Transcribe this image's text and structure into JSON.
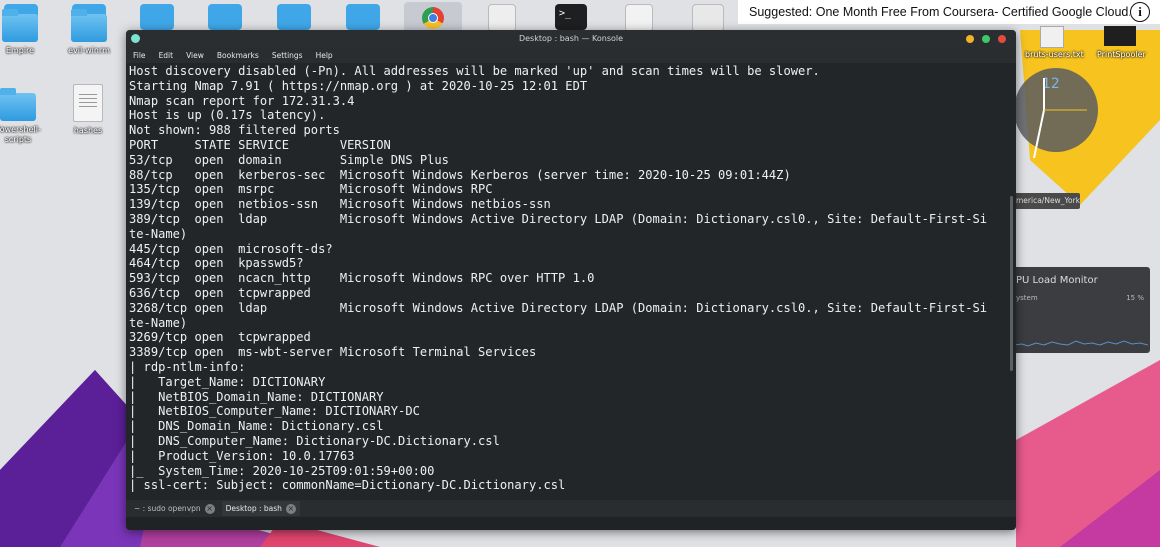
{
  "banner": {
    "text": "Suggested: One Month Free From Coursera- Certified Google Cloud...",
    "info_icon": "info-icon",
    "info_glyph": "i"
  },
  "desktop": {
    "left_icons": [
      {
        "label": "Empire",
        "type": "folder"
      },
      {
        "label": "evil-winrm",
        "type": "folder"
      },
      {
        "label": "Powershell-\nscripts",
        "type": "folder"
      },
      {
        "label": "hashes",
        "type": "document"
      }
    ],
    "right_icons": [
      {
        "label": "bruts-users.txt"
      },
      {
        "label": "PrintSpooler"
      }
    ],
    "clock": {
      "timezone": "merica/New_York",
      "hour_mark": "12"
    },
    "cpu_monitor": {
      "title": "PU Load Monitor",
      "system_label": "ystem",
      "value": "15 %"
    }
  },
  "konsole": {
    "title": "Desktop : bash — Konsole",
    "menu": [
      "File",
      "Edit",
      "View",
      "Bookmarks",
      "Settings",
      "Help"
    ],
    "colors": {
      "bg": "#232629",
      "text": "#eff0f1",
      "close": "#e34b3d",
      "max": "#3fc86a",
      "min": "#f1b427"
    },
    "lines": [
      "Host discovery disabled (-Pn). All addresses will be marked 'up' and scan times will be slower.",
      "Starting Nmap 7.91 ( https://nmap.org ) at 2020-10-25 12:01 EDT",
      "Nmap scan report for 172.31.3.4",
      "Host is up (0.17s latency).",
      "Not shown: 988 filtered ports",
      "PORT     STATE SERVICE       VERSION",
      "53/tcp   open  domain        Simple DNS Plus",
      "88/tcp   open  kerberos-sec  Microsoft Windows Kerberos (server time: 2020-10-25 09:01:44Z)",
      "135/tcp  open  msrpc         Microsoft Windows RPC",
      "139/tcp  open  netbios-ssn   Microsoft Windows netbios-ssn",
      "389/tcp  open  ldap          Microsoft Windows Active Directory LDAP (Domain: Dictionary.csl0., Site: Default-First-Si",
      "te-Name)",
      "445/tcp  open  microsoft-ds?",
      "464/tcp  open  kpasswd5?",
      "593/tcp  open  ncacn_http    Microsoft Windows RPC over HTTP 1.0",
      "636/tcp  open  tcpwrapped",
      "3268/tcp open  ldap          Microsoft Windows Active Directory LDAP (Domain: Dictionary.csl0., Site: Default-First-Si",
      "te-Name)",
      "3269/tcp open  tcpwrapped",
      "3389/tcp open  ms-wbt-server Microsoft Terminal Services",
      "| rdp-ntlm-info:",
      "|   Target_Name: DICTIONARY",
      "|   NetBIOS_Domain_Name: DICTIONARY",
      "|   NetBIOS_Computer_Name: DICTIONARY-DC",
      "|   DNS_Domain_Name: Dictionary.csl",
      "|   DNS_Computer_Name: Dictionary-DC.Dictionary.csl",
      "|   Product_Version: 10.0.17763",
      "|_  System_Time: 2020-10-25T09:01:59+00:00",
      "| ssl-cert: Subject: commonName=Dictionary-DC.Dictionary.csl"
    ],
    "tabs": [
      {
        "label": "~ : sudo openvpn",
        "active": false
      },
      {
        "label": "Desktop : bash",
        "active": true
      }
    ],
    "tab_close_glyph": "×"
  }
}
